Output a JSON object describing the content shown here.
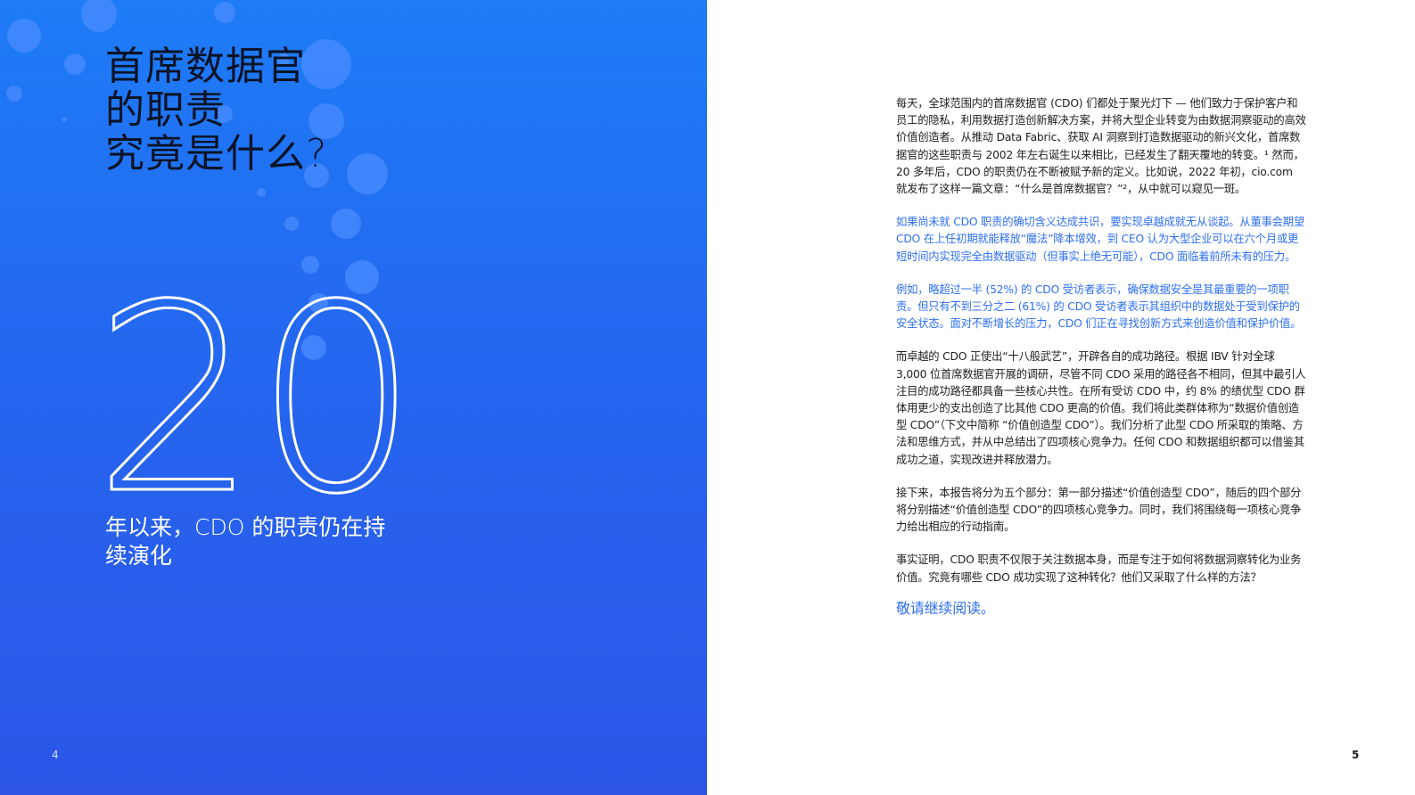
{
  "left_page": {
    "title_lines": [
      "首席数据官",
      "的职责",
      "究竟是什么?"
    ],
    "big_number": "20",
    "caption": "年以来，CDO 的职责仍在持续演化",
    "page_number": "4"
  },
  "right_page": {
    "paragraphs": [
      "每天，全球范围内的首席数据官 (CDO) 们都处于聚光灯下 — 他们致力于保护客户和员工的隐私，利用数据打造创新解决方案，并将大型企业转变为由数据洞察驱动的高效价值创造者。从推动 Data Fabric、获取 AI 洞察到打造数据驱动的新兴文化，首席数据官的这些职责与 2002 年左右诞生以来相比，已经发生了翻天覆地的转变。¹ 然而，20 多年后，CDO 的职责仍在不断被赋予新的定义。比如说，2022 年初，cio.com 就发布了这样一篇文章：“什么是首席数据官？”²，从中就可以窥见一斑。",
      "如果尚未就 CDO 职责的确切含义达成共识，要实现卓越成就无从谈起。从董事会期望 CDO 在上任初期就能释放“魔法”降本增效，到 CEO 认为大型企业可以在六个月或更短时间内实现完全由数据驱动（但事实上绝无可能），CDO 面临着前所未有的压力。",
      "例如，略超过一半 (52%) 的 CDO 受访者表示，确保数据安全是其最重要的一项职责。但只有不到三分之二 (61%) 的 CDO 受访者表示其组织中的数据处于受到保护的安全状态。面对不断增长的压力，CDO 们正在寻找创新方式来创造价值和保护价值。",
      "而卓越的 CDO 正使出“十八般武艺”，开辟各自的成功路径。根据 IBV 针对全球 3,000 位首席数据官开展的调研，尽管不同 CDO 采用的路径各不相同，但其中最引人注目的成功路径都具备一些核心共性。在所有受访 CDO 中，约 8% 的绩优型 CDO 群体用更少的支出创造了比其他 CDO 更高的价值。我们将此类群体称为“数据价值创造型 CDO”（下文中简称 “价值创造型 CDO”）。我们分析了此型 CDO 所采取的策略、方法和思维方式，并从中总结出了四项核心竞争力。任何 CDO 和数据组织都可以借鉴其成功之道，实现改进并释放潜力。",
      "接下来，本报告将分为五个部分：第一部分描述“价值创造型 CDO”，随后的四个部分将分别描述“价值创造型 CDO”的四项核心竞争力。同时，我们将围绕每一项核心竞争力给出相应的行动指南。",
      "事实证明，CDO 职责不仅限于关注数据本身，而是专注于如何将数据洞察转化为业务价值。究竟有哪些 CDO 成功实现了这种转化？他们又采取了什么样的方法？"
    ],
    "read_more": "敬请继续阅读。",
    "page_number": "5"
  },
  "colors": {
    "background_blue": "#2567f0",
    "accent_blue_text": "#2d6ff2",
    "title_color": "#0b1326"
  }
}
